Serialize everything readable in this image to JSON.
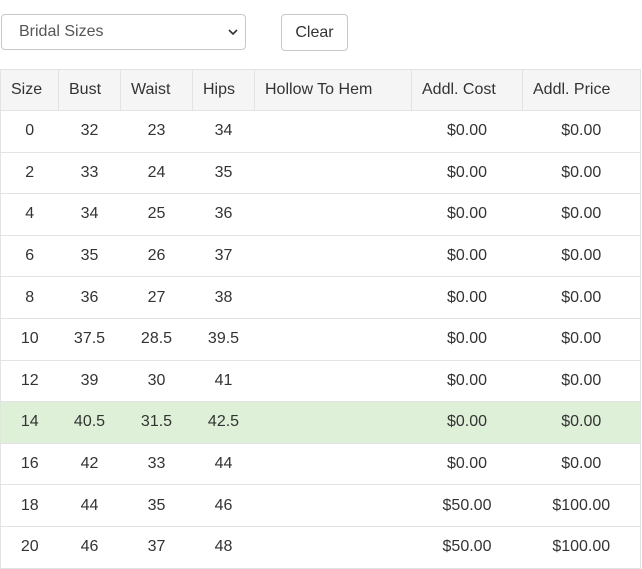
{
  "filter": {
    "selected": "Bridal Sizes"
  },
  "toolbar": {
    "clear_label": "Clear"
  },
  "table": {
    "headers": [
      "Size",
      "Bust",
      "Waist",
      "Hips",
      "Hollow To Hem",
      "Addl. Cost",
      "Addl. Price"
    ],
    "rows": [
      [
        "0",
        "32",
        "23",
        "34",
        "",
        "$0.00",
        "$0.00"
      ],
      [
        "2",
        "33",
        "24",
        "35",
        "",
        "$0.00",
        "$0.00"
      ],
      [
        "4",
        "34",
        "25",
        "36",
        "",
        "$0.00",
        "$0.00"
      ],
      [
        "6",
        "35",
        "26",
        "37",
        "",
        "$0.00",
        "$0.00"
      ],
      [
        "8",
        "36",
        "27",
        "38",
        "",
        "$0.00",
        "$0.00"
      ],
      [
        "10",
        "37.5",
        "28.5",
        "39.5",
        "",
        "$0.00",
        "$0.00"
      ],
      [
        "12",
        "39",
        "30",
        "41",
        "",
        "$0.00",
        "$0.00"
      ],
      [
        "14",
        "40.5",
        "31.5",
        "42.5",
        "",
        "$0.00",
        "$0.00"
      ],
      [
        "16",
        "42",
        "33",
        "44",
        "",
        "$0.00",
        "$0.00"
      ],
      [
        "18",
        "44",
        "35",
        "46",
        "",
        "$50.00",
        "$100.00"
      ],
      [
        "20",
        "46",
        "37",
        "48",
        "",
        "$50.00",
        "$100.00"
      ]
    ],
    "highlighted_row": 7,
    "highlight_color": "#dff0d8"
  }
}
